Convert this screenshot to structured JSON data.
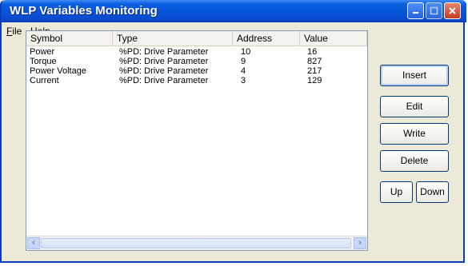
{
  "window": {
    "title": "WLP Variables Monitoring"
  },
  "menu": [
    {
      "accel": "F",
      "rest": "ile"
    },
    {
      "accel": "H",
      "rest": "elp"
    }
  ],
  "table": {
    "columns": [
      "Symbol",
      "Type",
      "Address",
      "Value"
    ],
    "rows": [
      [
        "Power",
        "%PD: Drive Parameter",
        "10",
        "16"
      ],
      [
        "Torque",
        "%PD: Drive Parameter",
        "9",
        "827"
      ],
      [
        "Power Voltage",
        "%PD: Drive Parameter",
        "4",
        "217"
      ],
      [
        "Current",
        "%PD: Drive Parameter",
        "3",
        "129"
      ]
    ]
  },
  "buttons": {
    "insert": "Insert",
    "edit": "Edit",
    "write": "Write",
    "delete": "Delete",
    "up": "Up",
    "down": "Down"
  },
  "icons": {
    "minimize": "minimize-icon",
    "maximize": "maximize-icon",
    "close": "close-icon",
    "scroll_left": "scroll-left-icon",
    "scroll_right": "scroll-right-icon"
  }
}
